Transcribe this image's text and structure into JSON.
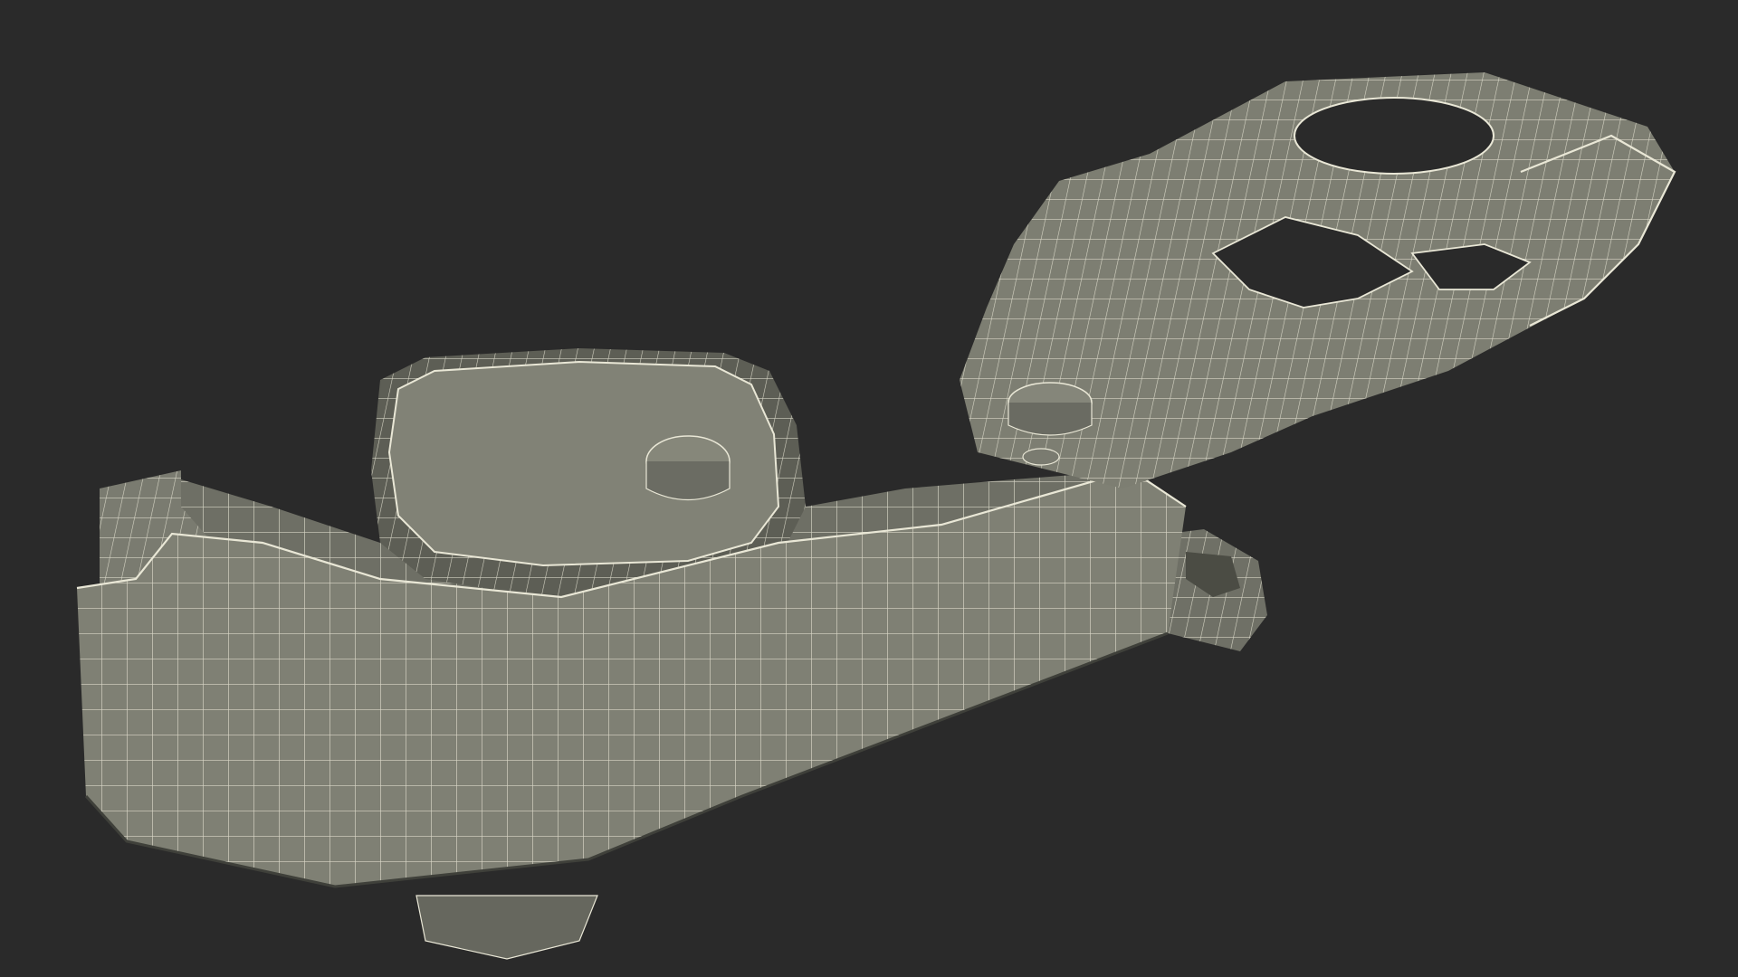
{
  "scene": {
    "background_color": "#2a2a2a",
    "surface_color": "#7d7e72",
    "surface_dark_color": "#55564d",
    "wire_color": "#e9e7d6",
    "subject_icon": "wireframe-mechanical-part-icon"
  }
}
